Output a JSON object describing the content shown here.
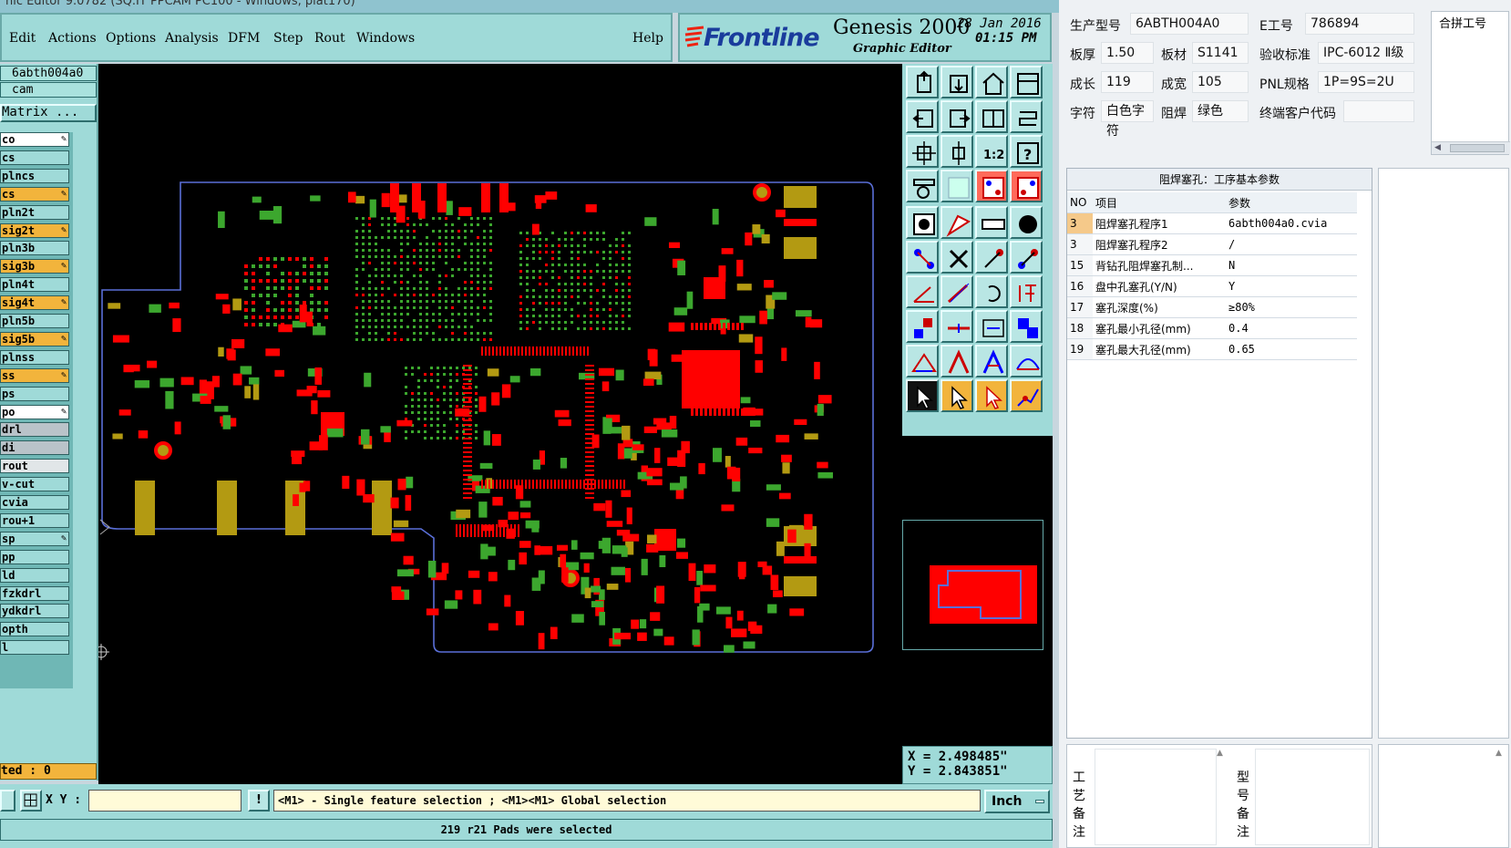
{
  "window_title": "Genesis 2000 Graphic Editor",
  "title_strip": "hic Editor 9.0782 (SQ.IT PPCAM PC100 - Windows, plat170)",
  "menu": [
    "Edit",
    "Actions",
    "Options",
    "Analysis",
    "DFM",
    "Step",
    "Rout",
    "Windows"
  ],
  "help_label": "Help",
  "logo": {
    "brand": "Frontline",
    "product": "Genesis 2000",
    "subtitle": "Graphic Editor",
    "date": "28 Jan 2016",
    "time": "01:15 PM"
  },
  "job": {
    "name": "6abth004a0",
    "step": "cam",
    "matrix_label": "Matrix ..."
  },
  "layers": [
    {
      "name": "co",
      "style": "white",
      "pen": true
    },
    {
      "name": "cs",
      "style": "teal",
      "pen": false
    },
    {
      "name": "plncs",
      "style": "teal",
      "pen": false
    },
    {
      "name": "cs",
      "style": "orange",
      "pen": true
    },
    {
      "name": "pln2t",
      "style": "teal",
      "pen": false
    },
    {
      "name": "sig2t",
      "style": "orange",
      "pen": true
    },
    {
      "name": "pln3b",
      "style": "teal",
      "pen": false
    },
    {
      "name": "sig3b",
      "style": "orange",
      "pen": true
    },
    {
      "name": "pln4t",
      "style": "teal",
      "pen": false
    },
    {
      "name": "sig4t",
      "style": "orange",
      "pen": true
    },
    {
      "name": "pln5b",
      "style": "teal",
      "pen": false
    },
    {
      "name": "sig5b",
      "style": "orange",
      "pen": true
    },
    {
      "name": "plnss",
      "style": "teal",
      "pen": false
    },
    {
      "name": "ss",
      "style": "orange",
      "pen": true
    },
    {
      "name": "ps",
      "style": "teal",
      "pen": false
    },
    {
      "name": "po",
      "style": "white",
      "pen": true
    },
    {
      "name": "drl",
      "style": "grey",
      "pen": false
    },
    {
      "name": "di",
      "style": "grey",
      "pen": false
    },
    {
      "name": "rout",
      "style": "lightgrey",
      "pen": false
    },
    {
      "name": "v-cut",
      "style": "teal",
      "pen": false
    },
    {
      "name": "cvia",
      "style": "teal",
      "pen": false
    },
    {
      "name": "rou+1",
      "style": "teal",
      "pen": false
    },
    {
      "name": "sp",
      "style": "teal",
      "pen": true
    },
    {
      "name": "pp",
      "style": "teal",
      "pen": false
    },
    {
      "name": "ld",
      "style": "teal",
      "pen": false
    },
    {
      "name": "fzkdrl",
      "style": "teal",
      "pen": false
    },
    {
      "name": "ydkdrl",
      "style": "teal",
      "pen": false
    },
    {
      "name": "opth",
      "style": "teal",
      "pen": false
    },
    {
      "name": "l",
      "style": "teal",
      "pen": false
    }
  ],
  "selected_count": "ted : 0",
  "coordinates": {
    "x": "X = 2.498485\"",
    "y": "Y = 2.843851\""
  },
  "xy_label": "X Y :",
  "xy_value": "",
  "prompt": "<M1> - Single feature selection ; <M1><M1> Global selection",
  "unit": "Inch",
  "status": "219 r21 Pads were selected",
  "info": {
    "part_no_label": "生产型号",
    "part_no": "6ABTH004A0",
    "e_no_label": "E工号",
    "e_no": "786894",
    "thickness_label": "板厚",
    "thickness": "1.50",
    "material_label": "板材",
    "material": "S1141",
    "accept_label": "验收标准",
    "accept": "IPC-6012 Ⅱ级",
    "length_label": "成长",
    "length": "119",
    "width_label": "成宽",
    "width": "105",
    "pnl_label": "PNL规格",
    "pnl": "1P=9S=2U",
    "char_label": "字符",
    "char": "白色字符",
    "mask_label": "阻焊",
    "mask": "绿色",
    "customer_label": "终端客户代码",
    "customer": "",
    "combine_label": "合拼工号"
  },
  "param_table": {
    "title": "阻焊塞孔：工序基本参数",
    "headers": [
      "NO",
      "项目",
      "参数"
    ],
    "rows": [
      [
        "3",
        "阻焊塞孔程序1",
        "6abth004a0.cvia"
      ],
      [
        "3",
        "阻焊塞孔程序2",
        "/"
      ],
      [
        "15",
        "背钻孔阻焊塞孔制...",
        "N"
      ],
      [
        "16",
        "盘中孔塞孔(Y/N)",
        "Y"
      ],
      [
        "17",
        "塞孔深度(%)",
        "≥80%"
      ],
      [
        "18",
        "塞孔最小孔径(mm)",
        "0.4"
      ],
      [
        "19",
        "塞孔最大孔径(mm)",
        "0.65"
      ]
    ]
  },
  "remarks": {
    "process_label": "工艺备注",
    "model_label": "型号备注"
  },
  "colors": {
    "teal": "#9fdad8",
    "orange": "#f2b43c",
    "red": "#ff0000",
    "green": "#3ca72e",
    "olive": "#b39a12",
    "outline": "#5a6fd8"
  }
}
